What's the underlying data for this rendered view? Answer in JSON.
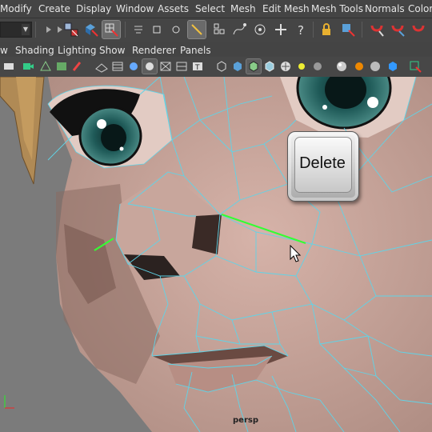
{
  "menubar": {
    "items": [
      "Modify",
      "Create",
      "Display",
      "Window",
      "Assets",
      "Select",
      "Mesh",
      "Edit Mesh",
      "Mesh Tools",
      "Normals",
      "Color"
    ]
  },
  "status_line": {
    "icons": [
      "mode-dropdown",
      "select-by-hierarchy-icon",
      "select-by-object-type-icon",
      "select-by-component-type-icon",
      "snap-to-grid-icon",
      "snap-to-curve-icon",
      "snap-to-point-icon",
      "snap-to-projected-center-icon",
      "help-icon",
      "lock-icon",
      "select-lock-icon",
      "magnet-snap-icon"
    ]
  },
  "panel_menu": {
    "items": [
      "w",
      "Shading",
      "Lighting",
      "Show",
      "Renderer",
      "Panels"
    ]
  },
  "viewport": {
    "camera_label": "persp",
    "overlay_key_label": "Delete",
    "selected_edge_color": "#33ff33",
    "wire_color": "#5fd4e8",
    "skin_color": "#c9a79c"
  }
}
